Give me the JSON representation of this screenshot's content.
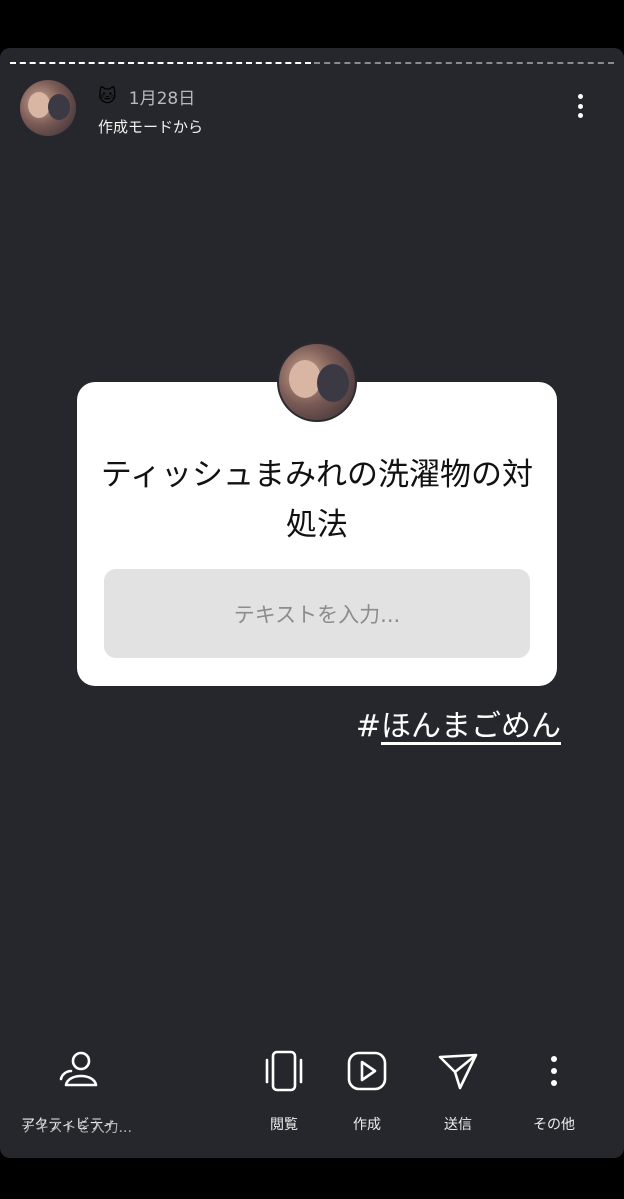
{
  "header": {
    "emoji": "🐱",
    "date": "1月28日",
    "mode": "作成モードから"
  },
  "card": {
    "question": "ティッシュまみれの洗濯物の対処法",
    "answer_placeholder": "テキストを入力..."
  },
  "hashtag": {
    "hash": "#",
    "tag": "ほんまごめん"
  },
  "bottom_bar": {
    "activity_label": "アクティビティ",
    "activity_overlap_text": "テキストを入力...",
    "view_label": "閲覧",
    "create_label": "作成",
    "send_label": "送信",
    "more_label": "その他"
  }
}
